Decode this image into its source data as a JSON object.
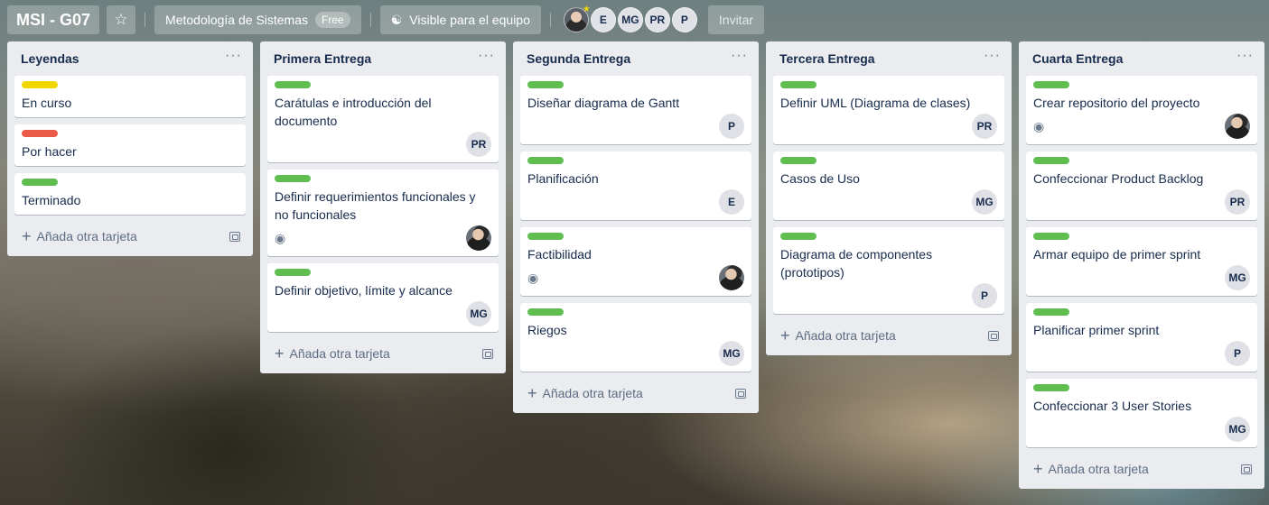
{
  "header": {
    "board_title": "MSI - G07",
    "team_name": "Metodología de Sistemas",
    "plan_badge": "Free",
    "visibility": "Visible para el equipo",
    "members": [
      "E",
      "MG",
      "PR",
      "P"
    ],
    "invite_label": "Invitar"
  },
  "colors": {
    "green": "#61bd4f",
    "yellow": "#f2d600",
    "red": "#eb5a46"
  },
  "add_card_label": "Añada otra tarjeta",
  "lists": [
    {
      "title": "Leyendas",
      "cards": [
        {
          "label": "yellow",
          "title": "En curso"
        },
        {
          "label": "red",
          "title": "Por hacer"
        },
        {
          "label": "green",
          "title": "Terminado"
        }
      ]
    },
    {
      "title": "Primera Entrega",
      "cards": [
        {
          "label": "green",
          "title": "Carátulas e introducción del documento",
          "member": "PR"
        },
        {
          "label": "green",
          "title": "Definir requerimientos funcionales y no funcionales",
          "watch": true,
          "member_photo": true
        },
        {
          "label": "green",
          "title": "Definir objetivo, límite y alcance",
          "member": "MG"
        }
      ]
    },
    {
      "title": "Segunda Entrega",
      "cards": [
        {
          "label": "green",
          "title": "Diseñar diagrama de Gantt",
          "member": "P"
        },
        {
          "label": "green",
          "title": "Planificación",
          "member": "E"
        },
        {
          "label": "green",
          "title": "Factibilidad",
          "watch": true,
          "member_photo": true
        },
        {
          "label": "green",
          "title": "Riegos",
          "member": "MG"
        }
      ]
    },
    {
      "title": "Tercera Entrega",
      "cards": [
        {
          "label": "green",
          "title": "Definir UML (Diagrama de clases)",
          "member": "PR"
        },
        {
          "label": "green",
          "title": "Casos de Uso",
          "member": "MG"
        },
        {
          "label": "green",
          "title": "Diagrama de componentes (prototipos)",
          "member": "P"
        }
      ]
    },
    {
      "title": "Cuarta Entrega",
      "cards": [
        {
          "label": "green",
          "title": "Crear repositorio del proyecto",
          "watch": true,
          "member_photo": true
        },
        {
          "label": "green",
          "title": "Confeccionar Product Backlog",
          "member": "PR"
        },
        {
          "label": "green",
          "title": "Armar equipo de primer sprint",
          "member": "MG"
        },
        {
          "label": "green",
          "title": "Planificar primer sprint",
          "member": "P"
        },
        {
          "label": "green",
          "title": "Confeccionar 3 User Stories",
          "member": "MG"
        }
      ]
    }
  ]
}
